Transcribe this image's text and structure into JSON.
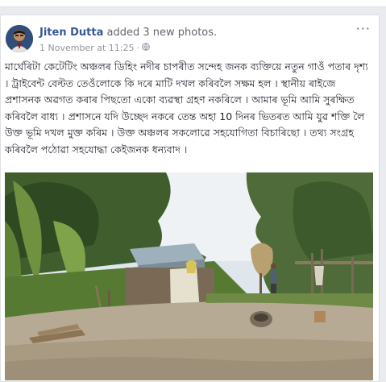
{
  "post": {
    "author": "Jiten Dutta",
    "action": "added 3 new photos.",
    "timestamp": "1 November at 11:25",
    "privacy_icon": "globe-icon",
    "more_label": "···",
    "text": "মাৰ্ঘেৰিটা কেটেটিং অঞ্চলৰ ডিহিং নদীৰ চাপৰীত সন্দেহ জনক ব্যক্তিয়ে নতুন গাওঁ পতাৰ দৃশ্য । ট্ৰাইবেন্ট বেল্টত তেওঁলোকে কি দৰে মাটি দখল কৰিবলৈ সক্ষম হল । স্থানীয় ৰাইজে প্ৰশাসনক অৱগত কৰাৰ পিছতো একো ব্যৱস্থা গ্ৰহণ নকৰিলে । আমাৰ ভূমি আমি সুৰক্ষিত কৰিবলৈ বাধ্য । প্ৰশাসনে যদি উচ্ছেদ নকৰে তেন্ত অহা 10 দিনৰ ভিতৰত আমি যুৱ শক্তি লৈ উক্ত ভূমি দখল মুক্ত কৰিম । উক্ত অঞ্চলৰ সকলোৱে সহযোগিতা বিচাৰিছো । তথ্য সংগ্ৰহ কৰিবলৈ পঠোৱা সহযোদ্ধা কেইজনক ধন্যবাদ ।"
  },
  "photo": {
    "description_icon": "photo-village-scene"
  }
}
